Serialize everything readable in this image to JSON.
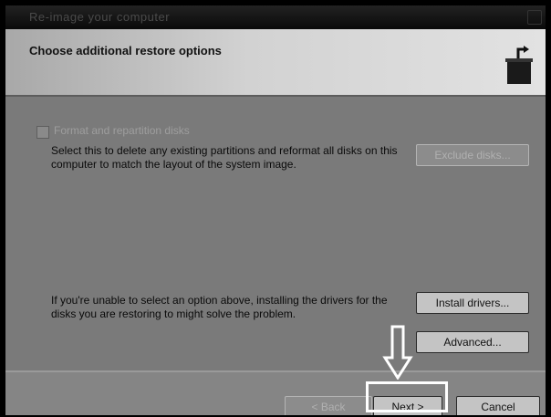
{
  "window": {
    "title": "Re-image your computer"
  },
  "header": {
    "title": "Choose additional restore options",
    "icon": "computer-restore-icon"
  },
  "options": {
    "format_checkbox": {
      "label": "Format and repartition disks",
      "checked": false,
      "enabled": false
    },
    "format_description": "Select this to delete any existing partitions and reformat all disks on this computer to match the layout of the system image.",
    "exclude_disks_label": "Exclude disks...",
    "drivers_description": "If you're unable to select an option above, installing the drivers for the disks you are restoring to might solve the problem.",
    "install_drivers_label": "Install drivers...",
    "advanced_label": "Advanced..."
  },
  "footer": {
    "back_label": "< Back",
    "next_label": "Next >",
    "cancel_label": "Cancel"
  },
  "annotation": {
    "arrow_icon": "down-arrow-icon",
    "color": "#ffffff"
  }
}
